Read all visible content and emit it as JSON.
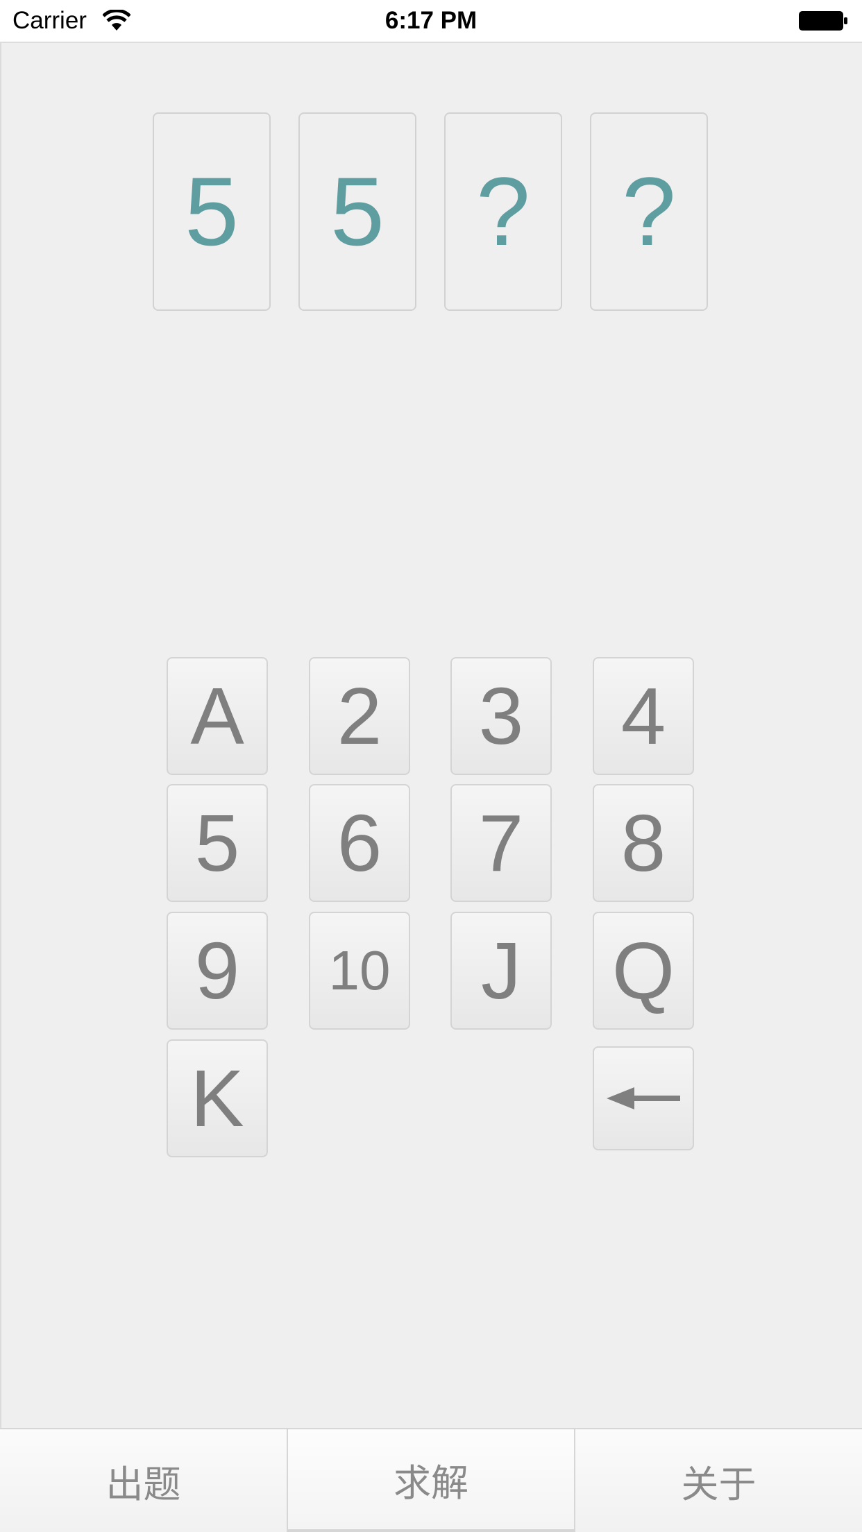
{
  "status_bar": {
    "carrier": "Carrier",
    "time": "6:17 PM"
  },
  "cards": [
    "5",
    "5",
    "?",
    "?"
  ],
  "colors": {
    "card_text": "#5f9ea0",
    "key_text": "#7f7f7f",
    "background": "#efefef"
  },
  "keypad": {
    "keys": [
      "A",
      "2",
      "3",
      "4",
      "5",
      "6",
      "7",
      "8",
      "9",
      "10",
      "J",
      "Q",
      "K"
    ],
    "backspace_icon": "left-arrow-icon"
  },
  "tab_bar": {
    "tabs": [
      "出题",
      "求解",
      "关于"
    ],
    "selected": "求解"
  }
}
